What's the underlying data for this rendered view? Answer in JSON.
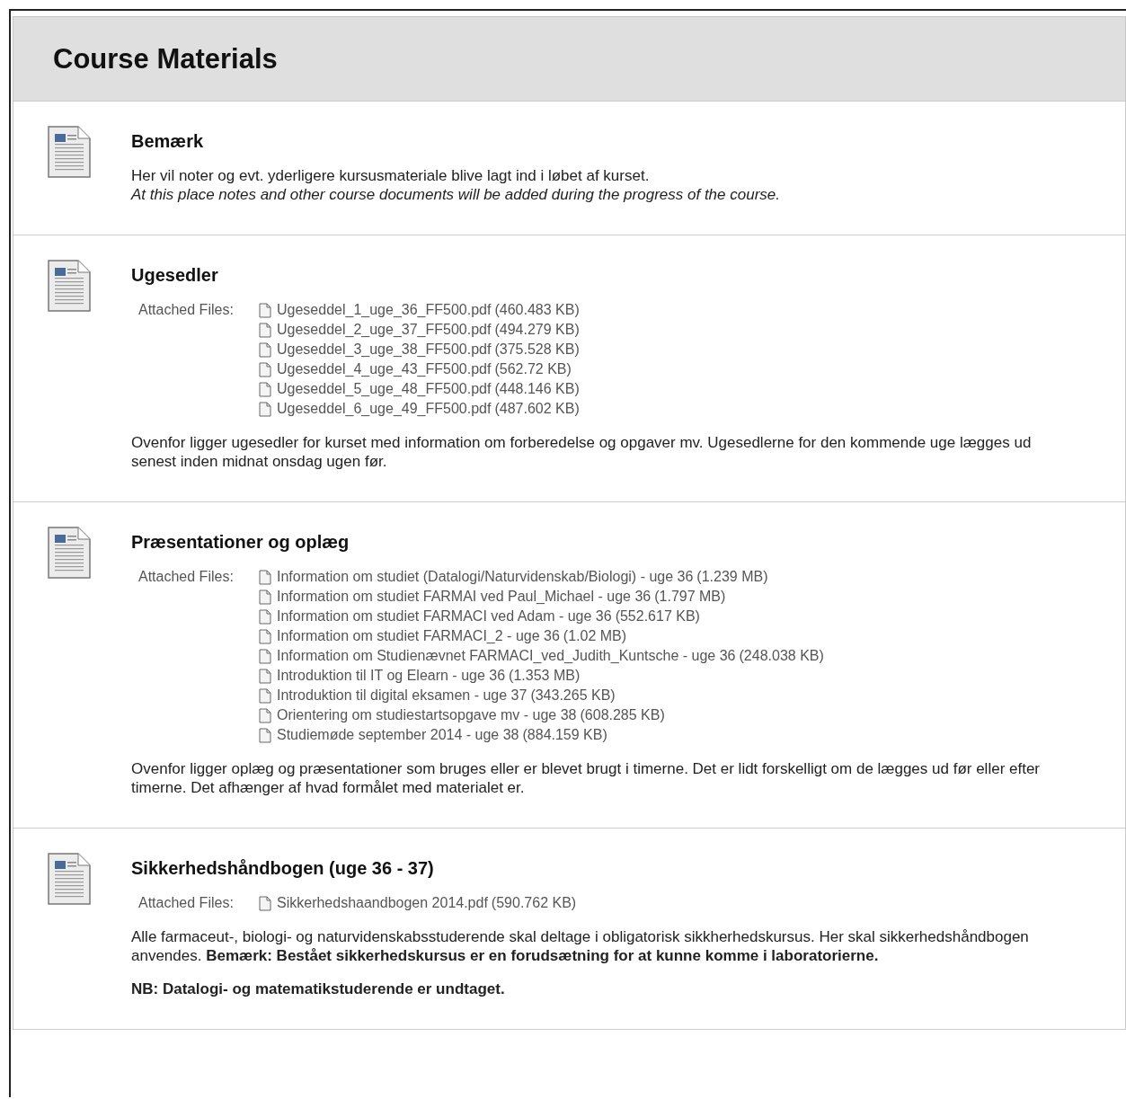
{
  "page": {
    "title": "Course Materials"
  },
  "items": [
    {
      "title": "Bemærk",
      "paragraphs": [
        {
          "kind": "plain",
          "text": "Her vil noter og evt. yderligere kursusmateriale blive lagt ind i løbet af kurset."
        },
        {
          "kind": "italic",
          "text": "At this place notes and other course documents will be added during the progress of the course."
        }
      ]
    },
    {
      "title": "Ugesedler",
      "files_label": "Attached Files:",
      "files": [
        {
          "name": "Ugeseddel_1_uge_36_FF500.pdf",
          "size": "(460.483 KB)"
        },
        {
          "name": "Ugeseddel_2_uge_37_FF500.pdf",
          "size": "(494.279 KB)"
        },
        {
          "name": "Ugeseddel_3_uge_38_FF500.pdf",
          "size": "(375.528 KB)"
        },
        {
          "name": "Ugeseddel_4_uge_43_FF500.pdf",
          "size": "(562.72 KB)"
        },
        {
          "name": "Ugeseddel_5_uge_48_FF500.pdf",
          "size": "(448.146 KB)"
        },
        {
          "name": "Ugeseddel_6_uge_49_FF500.pdf",
          "size": "(487.602 KB)"
        }
      ],
      "paragraphs": [
        {
          "kind": "plain",
          "text": "Ovenfor ligger ugesedler for kurset med information om forberedelse og opgaver mv. Ugesedlerne for den kommende uge lægges ud senest inden midnat onsdag ugen før."
        }
      ]
    },
    {
      "title": "Præsentationer og oplæg",
      "files_label": "Attached Files:",
      "files": [
        {
          "name": "Information om studiet (Datalogi/Naturvidenskab/Biologi) - uge 36",
          "size": "(1.239 MB)"
        },
        {
          "name": "Information om studiet FARMAI ved Paul_Michael - uge 36",
          "size": "(1.797 MB)"
        },
        {
          "name": "Information om studiet FARMACI ved Adam - uge 36",
          "size": "(552.617 KB)"
        },
        {
          "name": "Information om studiet FARMACI_2 - uge 36",
          "size": "(1.02 MB)"
        },
        {
          "name": "Information om Studienævnet FARMACI_ved_Judith_Kuntsche - uge 36",
          "size": "(248.038 KB)"
        },
        {
          "name": "Introduktion til IT og Elearn - uge 36",
          "size": "(1.353 MB)"
        },
        {
          "name": "Introduktion til digital eksamen - uge 37",
          "size": "(343.265 KB)"
        },
        {
          "name": "Orientering om studiestartsopgave mv - uge 38",
          "size": "(608.285 KB)"
        },
        {
          "name": "Studiemøde september 2014 - uge 38",
          "size": "(884.159 KB)"
        }
      ],
      "paragraphs": [
        {
          "kind": "plain",
          "text": "Ovenfor ligger oplæg og præsentationer som bruges eller er blevet brugt i timerne. Det er lidt forskelligt om de lægges ud før eller efter timerne. Det afhænger af hvad formålet med materialet er."
        }
      ]
    },
    {
      "title": "Sikkerhedshåndbogen (uge 36 - 37)",
      "files_label": "Attached Files:",
      "files": [
        {
          "name": "Sikkerhedshaandbogen 2014.pdf",
          "size": "(590.762 KB)"
        }
      ],
      "paragraphs": [
        {
          "kind": "plain",
          "text": "Alle farmaceut-, biologi- og naturvidenskabsstuderende skal deltage i obligatorisk sikkherhedskursus. Her skal sikkerhedshåndbogen anvendes. **Bemærk: Bestået sikkerhedskursus er en forudsætning for at kunne komme i laboratorierne.**"
        },
        {
          "kind": "bold",
          "text": "NB: Datalogi- og matematikstuderende er undtaget."
        }
      ]
    }
  ]
}
